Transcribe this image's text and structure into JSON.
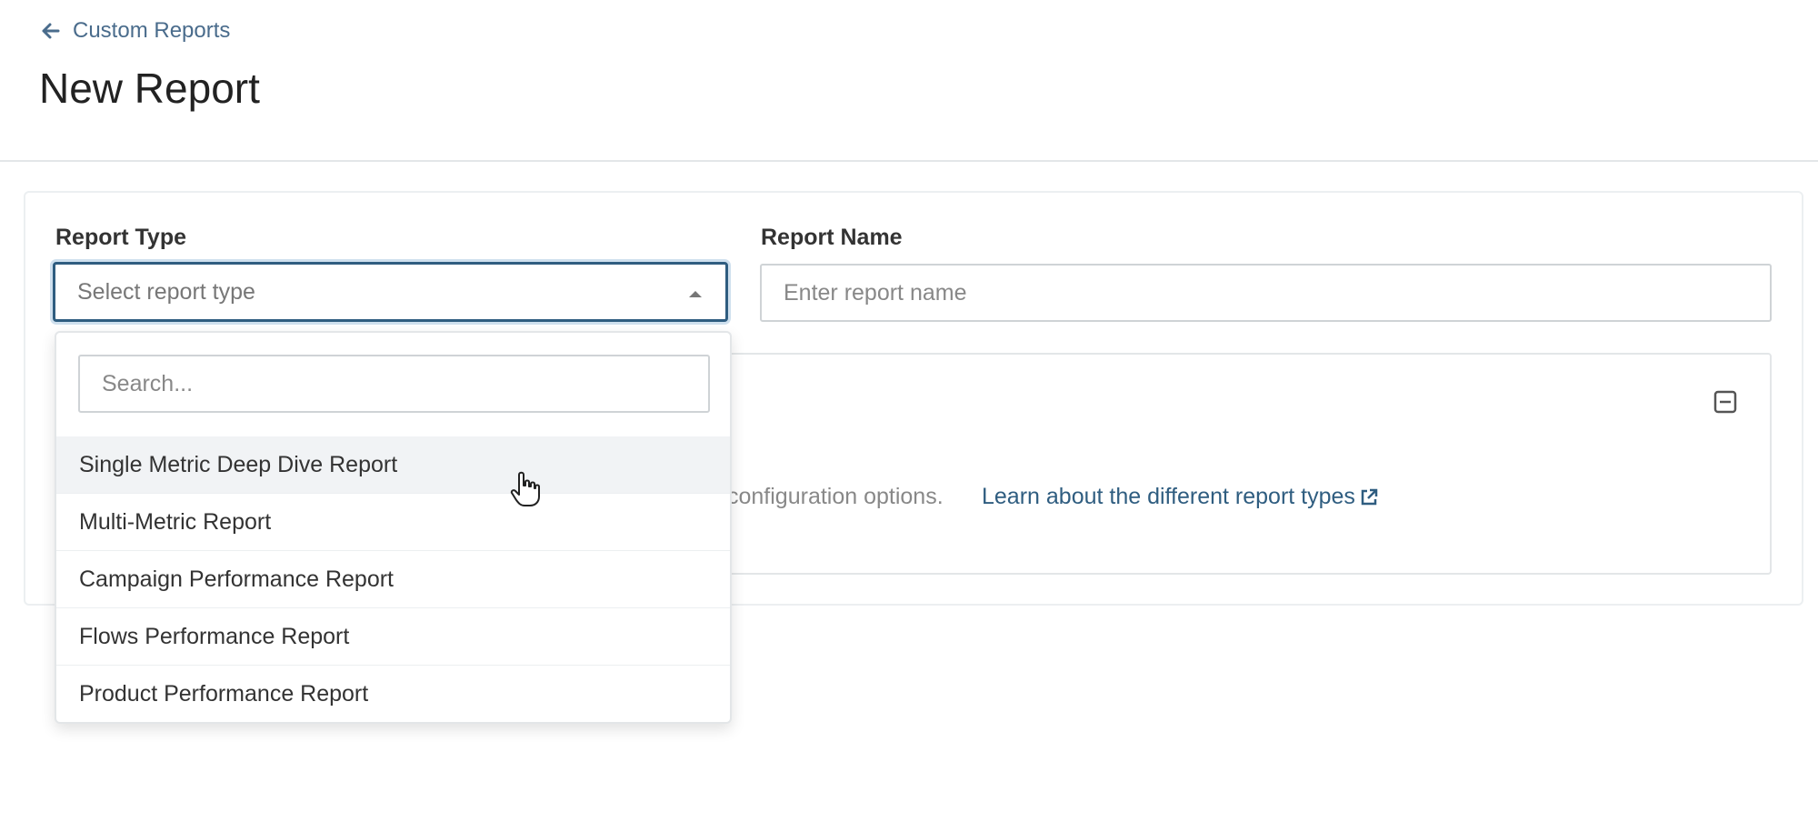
{
  "header": {
    "breadcrumb": "Custom Reports",
    "title": "New Report"
  },
  "form": {
    "report_type_label": "Report Type",
    "report_type_placeholder": "Select report type",
    "report_name_label": "Report Name",
    "report_name_placeholder": "Enter report name"
  },
  "dropdown": {
    "search_placeholder": "Search...",
    "options": [
      "Single Metric Deep Dive Report",
      "Multi-Metric Report",
      "Campaign Performance Report",
      "Flows Performance Report",
      "Product Performance Report"
    ],
    "hovered_option": "Single Metric Deep Dive Report"
  },
  "info": {
    "text": "configuration options.",
    "link": "Learn about the different report types"
  },
  "colors": {
    "link": "#4a6c8c",
    "accent": "#2f5d80",
    "border": "#e3e6e8"
  },
  "icons": [
    "arrow-left-icon",
    "caret-up-icon",
    "collapse-icon",
    "external-link-icon",
    "hand-cursor-icon"
  ]
}
